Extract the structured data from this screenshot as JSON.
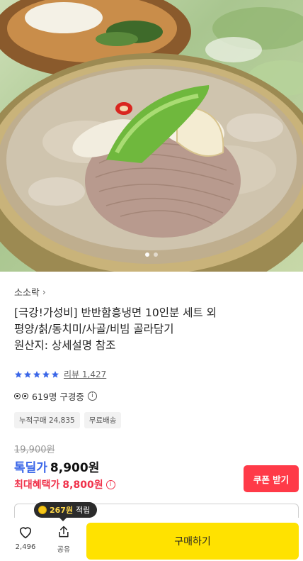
{
  "product": {
    "brand": "소소락",
    "title_lines": [
      "[극강!가성비] 반반함흥냉면 10인분 세트 외",
      "평양/칡/동치미/사골/비빔 골라담기",
      "원산지: 상세설명 참조"
    ],
    "rating_stars": 5,
    "review_label": "리뷰 1,427",
    "viewing_text": "619명 구경중",
    "tags": [
      "누적구매 24,835",
      "무료배송"
    ],
    "original_price": "19,900원",
    "deal_label": "톡딜가",
    "deal_price": "8,900원",
    "max_benefit_label": "최대혜택가",
    "max_benefit_price": "8,800원",
    "coupon_button": "쿠폰 받기"
  },
  "gallery": {
    "image_count": 2,
    "active_index": 0
  },
  "bottom_bar": {
    "points_amount": "267원",
    "points_suffix": "적립",
    "like_count": "2,496",
    "share_label": "공유",
    "buy_button": "구매하기"
  },
  "colors": {
    "deal_blue": "#3a66e8",
    "benefit_red": "#f0314a",
    "coupon_red": "#ff3a48",
    "buy_yellow": "#ffe200",
    "star_blue": "#3a66e8"
  },
  "icons": {
    "star": "star-icon",
    "eyes": "eyes-icon",
    "info": "info-icon",
    "heart": "heart-icon",
    "share": "share-icon",
    "coin": "coin-icon"
  }
}
